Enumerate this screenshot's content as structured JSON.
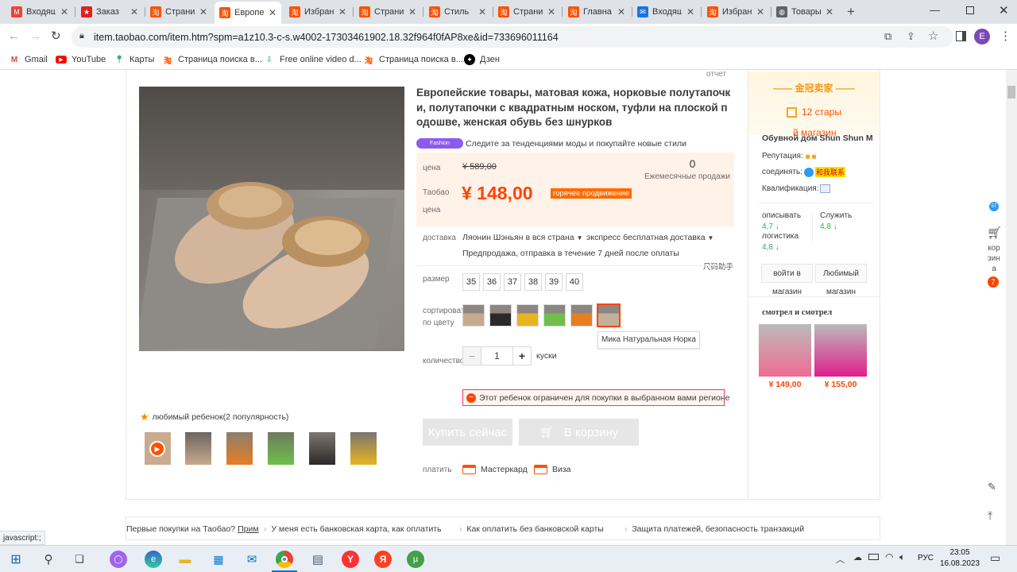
{
  "browser": {
    "tabs": [
      {
        "label": "Входящ",
        "fav": "M",
        "fav_color": "#ea4335"
      },
      {
        "label": "Заказ",
        "fav": "★",
        "fav_color": "#e02020"
      },
      {
        "label": "Страни",
        "fav": "淘",
        "fav_color": "#ff5000"
      },
      {
        "label": "Европе",
        "fav": "淘",
        "fav_color": "#ff5000"
      },
      {
        "label": "Избран",
        "fav": "淘",
        "fav_color": "#ff5000"
      },
      {
        "label": "Страни",
        "fav": "淘",
        "fav_color": "#ff5000"
      },
      {
        "label": "Стиль",
        "fav": "淘",
        "fav_color": "#ff5000"
      },
      {
        "label": "Страни",
        "fav": "淘",
        "fav_color": "#ff5000"
      },
      {
        "label": "Главна",
        "fav": "淘",
        "fav_color": "#ff5000"
      },
      {
        "label": "Входящ",
        "fav": "✉",
        "fav_color": "#1a73e8"
      },
      {
        "label": "Избран",
        "fav": "淘",
        "fav_color": "#ff5000"
      },
      {
        "label": "Товары",
        "fav": "◍",
        "fav_color": "#5f6368"
      }
    ],
    "url": "item.taobao.com/item.htm?spm=a1z10.3-c-s.w4002-17303461902.18.32f964f0fAP8xe&id=733696011164",
    "profile_initial": "E",
    "bookmarks": [
      {
        "label": "Gmail",
        "icon": "gmail-icon"
      },
      {
        "label": "YouTube",
        "icon": "youtube-icon"
      },
      {
        "label": "Карты",
        "icon": "maps-icon"
      },
      {
        "label": "Страница поиска в...",
        "icon": "taobao-icon"
      },
      {
        "label": "Free online video d...",
        "icon": "video-download-icon"
      },
      {
        "label": "Страница поиска в...",
        "icon": "taobao-icon"
      },
      {
        "label": "Дзен",
        "icon": "dzen-icon"
      }
    ]
  },
  "product": {
    "report_link": "отчет",
    "title": "Европейские товары, матовая кожа, норковые полутапочки, полутапочки с квадратным носком, туфли на плоской подошве, женская обувь без шнурков",
    "fashion_badge": "Fashion",
    "fashion_text": "Следите за тенденциями моды и покупайте новые стили",
    "price_label": "цена",
    "original_price": "¥ 589,00",
    "monthly_sales_value": "0",
    "monthly_sales_label": "Ежемесячные продажи",
    "taobao_price_label": "Таобао цена",
    "current_price": "¥ 148,00",
    "promo_badge": "горячее продвижение",
    "delivery_label": "доставка",
    "delivery_from": "Ляонин Шэньян в вся страна",
    "delivery_type": "экспресс бесплатная доставка",
    "preorder_text": "Предпродажа, отправка в течение 7 дней после оплаты",
    "size_helper": "尺码助手",
    "size_label": "размер",
    "sizes": [
      "35",
      "36",
      "37",
      "38",
      "39",
      "40"
    ],
    "color_label": "сортировать по цвету",
    "colors_swatches": [
      "#c7a98e",
      "#2a2a2a",
      "#e8b51e",
      "#6fbf4a",
      "#e67e22",
      "#c3b09a"
    ],
    "selected_color_tooltip": "Мика Натуральная Норка",
    "qty_label": "количество",
    "qty_minus": "−",
    "qty_value": "1",
    "qty_plus": "+",
    "qty_unit": "куски",
    "restriction_text": "Этот ребенок ограничен для покупки в выбранном вами регионе",
    "buy_now": "Купить сейчас",
    "add_to_cart": "В корзину",
    "pay_label": "платить",
    "pay_methods": [
      "Мастеркард",
      "Виза"
    ],
    "favorite_text": "любимый ребенок(2 популярность)"
  },
  "seller": {
    "crown_title": "金冠卖家",
    "level": "12 стары",
    "shop_link": "й магазин",
    "shop_name": "Обувной дом Shun Shun M",
    "reputation_label": "Репутация:",
    "connect_label": "соединять:",
    "connect_badge": "和我联系",
    "qualification_label": "Квалификация:",
    "rate_describe_label": "описывать",
    "rate_describe_value": "4,7",
    "rate_service_label": "Служить",
    "rate_service_value": "4,8",
    "rate_logistics_label": "логистика",
    "rate_logistics_value": "4,8",
    "enter_shop": "войти в магазин",
    "favorite_shop": "Любимый магазин",
    "seen_title": "смотрел и смотрел",
    "seen_items": [
      {
        "price": "¥ 149,00",
        "color": "#f06c92"
      },
      {
        "price": "¥ 155,00",
        "color": "#e01e8c"
      }
    ]
  },
  "side": {
    "cart_label": "корзина",
    "cart_count": "7",
    "float_badge": "57"
  },
  "footer": {
    "links": [
      "Первые покупки на Таобао?",
      "Прим",
      "У меня есть банковская карта, как оплатить",
      "Как оплатить без банковской карты",
      "Защита платежей, безопасность транзакций"
    ],
    "status_text": "javascript:;"
  },
  "taskbar": {
    "lang": "РУС",
    "time": "23:05",
    "date": "16.08.2023"
  }
}
